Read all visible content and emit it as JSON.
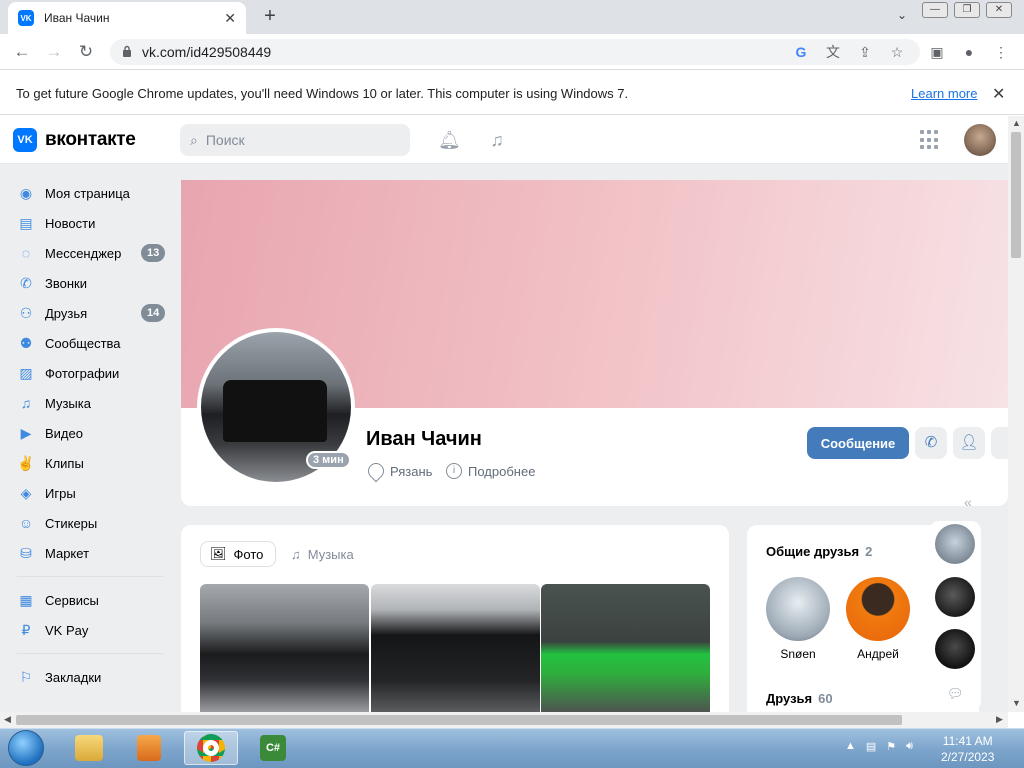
{
  "browser": {
    "tab_title": "Иван Чачин",
    "favicon_text": "VK",
    "url": "vk.com/id429508449",
    "infobar_text": "To get future Google Chrome updates, you'll need Windows 10 or later. This computer is using Windows 7.",
    "infobar_link": "Learn more"
  },
  "vk": {
    "logo_text": "VK",
    "brand": "вконтакте",
    "search_placeholder": "Поиск",
    "sidebar": {
      "items": [
        {
          "label": "Моя страница",
          "icon": "user-circle-icon"
        },
        {
          "label": "Новости",
          "icon": "news-icon"
        },
        {
          "label": "Мессенджер",
          "icon": "message-icon",
          "badge": "13"
        },
        {
          "label": "Звонки",
          "icon": "phone-icon"
        },
        {
          "label": "Друзья",
          "icon": "friends-icon",
          "badge": "14"
        },
        {
          "label": "Сообщества",
          "icon": "communities-icon"
        },
        {
          "label": "Фотографии",
          "icon": "photo-icon"
        },
        {
          "label": "Музыка",
          "icon": "music-icon"
        },
        {
          "label": "Видео",
          "icon": "video-icon"
        },
        {
          "label": "Клипы",
          "icon": "clips-icon"
        },
        {
          "label": "Игры",
          "icon": "games-icon"
        },
        {
          "label": "Стикеры",
          "icon": "stickers-icon"
        },
        {
          "label": "Маркет",
          "icon": "market-icon"
        }
      ],
      "items2": [
        {
          "label": "Сервисы",
          "icon": "services-icon"
        },
        {
          "label": "VK Pay",
          "icon": "vkpay-icon"
        }
      ],
      "items3": [
        {
          "label": "Закладки",
          "icon": "bookmark-icon"
        }
      ]
    },
    "profile": {
      "name": "Иван Чачин",
      "online": "3 мин",
      "city": "Рязань",
      "more": "Подробнее",
      "message_button": "Сообщение"
    },
    "media_tabs": {
      "photo": "Фото",
      "music": "Музыка"
    },
    "friends": {
      "mutual_title": "Общие друзья",
      "mutual_count": "2",
      "mutual": [
        {
          "name": "Snøen"
        },
        {
          "name": "Андрей"
        }
      ],
      "friends_title": "Друзья",
      "friends_count": "60"
    }
  },
  "taskbar": {
    "time": "11:41 AM",
    "date": "2/27/2023"
  },
  "colors": {
    "vk_blue": "#0077ff",
    "button_blue": "#447bba",
    "badge_gray": "#818c99",
    "page_bg": "#edeef0"
  }
}
